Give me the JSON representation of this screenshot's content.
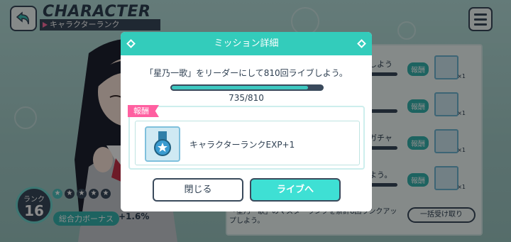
{
  "header": {
    "title": "CHARACTER",
    "subtitle": "キャラクターランク"
  },
  "character": {
    "rank_label": "ランク",
    "rank": "16",
    "stars_filled": 1,
    "stars_total": 5,
    "bonus_label": "総合力ボーナス",
    "bonus_value": "+1.6%"
  },
  "list": {
    "rows": [
      {
        "text": "しよう",
        "reward_label": "報酬",
        "count": "×1"
      },
      {
        "text": "",
        "reward_label": "報酬",
        "count": "×1"
      },
      {
        "text": "ガチャ",
        "reward_label": "報酬",
        "count": "×1"
      },
      {
        "text": "よう。",
        "reward_label": "報酬",
        "count": "×1"
      }
    ],
    "bottom_text": "「星乃一歌」のマスターランクを累計6回ランクアップしよう。",
    "collect_all_label": "一括受け取り"
  },
  "modal": {
    "title": "ミッション詳細",
    "description": "「星乃一歌」をリーダーにして810回ライブしよう。",
    "progress_current": 735,
    "progress_total": 810,
    "progress_text": "735/810",
    "reward_tag": "報酬",
    "reward_name": "キャラクターランクEXP+1",
    "close_label": "閉じる",
    "live_label": "ライブへ"
  },
  "colors": {
    "accent": "#33ccbb",
    "pink": "#ff5fa0",
    "dark": "#3a4a5c"
  }
}
